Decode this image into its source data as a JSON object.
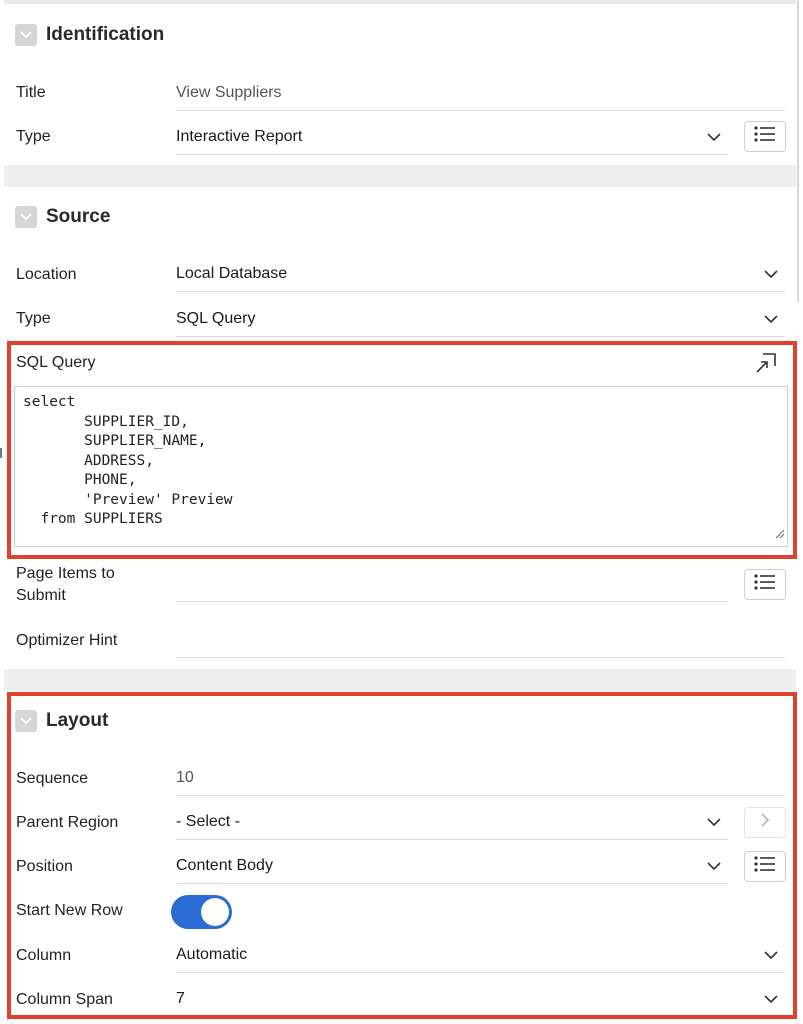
{
  "identification": {
    "heading": "Identification",
    "title_label": "Title",
    "title_value": "View Suppliers",
    "type_label": "Type",
    "type_value": "Interactive Report"
  },
  "source": {
    "heading": "Source",
    "location_label": "Location",
    "location_value": "Local Database",
    "type_label": "Type",
    "type_value": "SQL Query",
    "sql_label": "SQL Query",
    "sql_query": "select\n       SUPPLIER_ID,\n       SUPPLIER_NAME,\n       ADDRESS,\n       PHONE,\n       'Preview' Preview\n  from SUPPLIERS",
    "page_items_label_line1": "Page Items to",
    "page_items_label_line2": "Submit",
    "page_items_value": "",
    "optimizer_label": "Optimizer Hint",
    "optimizer_value": ""
  },
  "layout": {
    "heading": "Layout",
    "sequence_label": "Sequence",
    "sequence_value": "10",
    "parent_region_label": "Parent Region",
    "parent_region_value": "- Select -",
    "position_label": "Position",
    "position_value": "Content Body",
    "start_new_row_label": "Start New Row",
    "start_new_row_on": true,
    "column_label": "Column",
    "column_value": "Automatic",
    "column_span_label": "Column Span",
    "column_span_value": "7"
  },
  "icons": {
    "collapse": "chevron-down-icon",
    "list": "list-icon",
    "expand": "expand-editor-icon",
    "next": "chevron-right-icon",
    "resize": "resize-grip-icon"
  },
  "colors": {
    "highlight": "#e0412b",
    "toggle_on": "#2b6bd6",
    "section_gap": "#efefef"
  }
}
